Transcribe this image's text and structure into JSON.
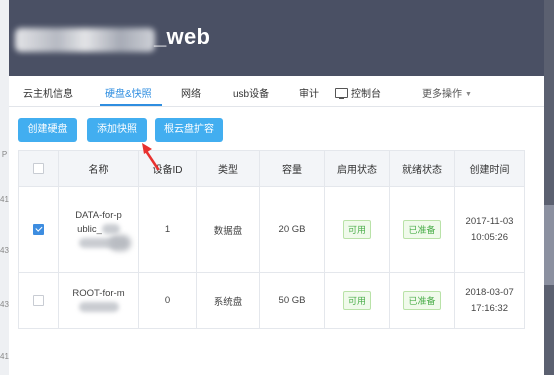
{
  "background": {
    "left_numbers": [
      "P",
      "41",
      "43",
      "43",
      "41"
    ]
  },
  "dialog": {
    "title": "_web"
  },
  "tabs": [
    {
      "label": "云主机信息"
    },
    {
      "label": "硬盘&快照"
    },
    {
      "label": "网络"
    },
    {
      "label": "usb设备"
    },
    {
      "label": "审计"
    },
    {
      "label": "控制台",
      "icon": "monitor-icon"
    },
    {
      "label": "更多操作",
      "icon": "caret-down-icon"
    }
  ],
  "toolbar": {
    "create_disk": "创建硬盘",
    "add_snapshot": "添加快照",
    "expand_root": "根云盘扩容"
  },
  "table": {
    "headers": [
      "",
      "名称",
      "设备ID",
      "类型",
      "容量",
      "启用状态",
      "就绪状态",
      "创建时间"
    ],
    "rows": [
      {
        "checked": true,
        "name_line1": "DATA-for-p",
        "name_line2": "ublic_",
        "device_id": "1",
        "type": "数据盘",
        "capacity": "20 GB",
        "enabled": "可用",
        "ready": "已准备",
        "date": "2017-11-03",
        "time": "10:05:26"
      },
      {
        "checked": false,
        "name_line1": "ROOT-for-m",
        "device_id": "0",
        "type": "系统盘",
        "capacity": "50 GB",
        "enabled": "可用",
        "ready": "已准备",
        "date": "2018-03-07",
        "time": "17:16:32"
      }
    ]
  },
  "colors": {
    "header_bg": "#4a5064",
    "accent": "#2f8ee0",
    "button": "#42aef0",
    "status_green": "#4cae4c",
    "arrow": "#e8312f"
  }
}
